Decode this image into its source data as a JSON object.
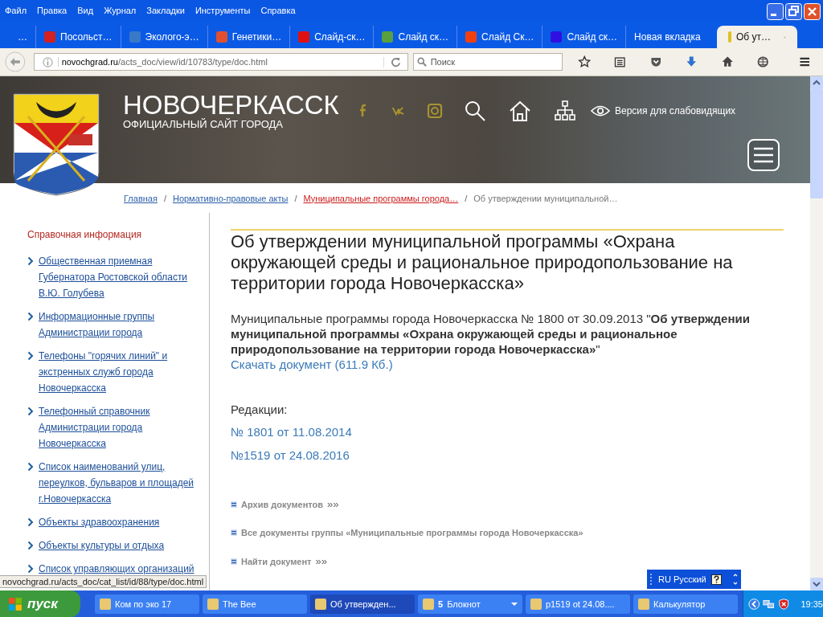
{
  "menu": [
    "Файл",
    "Правка",
    "Вид",
    "Журнал",
    "Закладки",
    "Инструменты",
    "Справка"
  ],
  "tabs": [
    {
      "label": "…",
      "selected": false
    },
    {
      "label": "Посольст…",
      "selected": false
    },
    {
      "label": "Эколого-э…",
      "selected": false
    },
    {
      "label": "Генетики…",
      "selected": false
    },
    {
      "label": "Слайд-ск…",
      "selected": false
    },
    {
      "label": "Слайд ск…",
      "selected": false
    },
    {
      "label": "Слайд Ск…",
      "selected": false
    },
    {
      "label": "Слайд ск…",
      "selected": false
    },
    {
      "label": "Новая вкладка",
      "selected": false
    },
    {
      "label": "Об ут…",
      "selected": true
    }
  ],
  "address": {
    "host": "novochgrad.ru",
    "path": "/acts_doc/view/id/10783/type/doc.html"
  },
  "search": {
    "placeholder": "Поиск"
  },
  "site": {
    "title": "НОВОЧЕРКАССК",
    "subtitle": "ОФИЦИАЛЬНЫЙ САЙТ ГОРОДА",
    "accessibility": "Версия для слабовидящих"
  },
  "breadcrumbs": {
    "separator": "/",
    "items": [
      {
        "label": "Главная",
        "kind": "link"
      },
      {
        "label": "Нормативно-правовые акты",
        "kind": "link"
      },
      {
        "label": "Муниципальные программы города…",
        "kind": "section"
      },
      {
        "label": "Об утверждении муниципальной…",
        "kind": "plain"
      }
    ]
  },
  "sidebar": {
    "heading": "Справочная информация",
    "items": [
      "Общественная приемная Губернатора Ростовской области В.Ю. Голубева",
      "Информационные группы Администрации города",
      "Телефоны \"горячих линий\" и экстренных служб города Новочеркасска",
      "Телефонный справочник Администрации города Новочеркасска",
      "Список наименований улиц, переулков, бульваров и площадей г.Новочеркасска",
      "Объекты здравоохранения",
      "Объекты культуры и отдыха",
      "Список управляющих организаций"
    ]
  },
  "article": {
    "title": "Об утверждении муниципальной программы «Охрана окружающей среды и рациональное природопользование на территории города Новочеркасска»",
    "intro": "Муниципальные программы города Новочеркасска № 1800 от 30.09.2013 \"**Об утверждении муниципальной программы «Охрана окружающей среды и рациональное природопользование на территории города Новочеркасска»**\"",
    "download": "Скачать документ (611.9 Кб.)",
    "revisions_heading": "Редакции:",
    "revisions": [
      "№ 1801 от 11.08.2014",
      "№1519 от 24.08.2016"
    ],
    "links": [
      {
        "label": "Архив документов",
        "suffix": "»»"
      },
      {
        "label": "Все документы группы «Муниципальные программы города Новочеркасска»"
      },
      {
        "label": "Найти документ",
        "suffix": "»»"
      }
    ]
  },
  "status_url": "novochgrad.ru/acts_doc/cat_list/id/88/type/doc.html",
  "language_bar": "RU Русский",
  "taskbar": {
    "start": "пуск",
    "items": [
      {
        "label": "Ком по эко 17",
        "selected": false
      },
      {
        "label": "The Bee",
        "selected": false
      },
      {
        "label": "Об утвержден...",
        "selected": true
      },
      {
        "label": "Блокнот",
        "count": "5",
        "selected": false
      },
      {
        "label": "p1519 ot 24.08....",
        "selected": false
      },
      {
        "label": "Калькулятор",
        "selected": false
      }
    ],
    "clock": "19:35"
  }
}
